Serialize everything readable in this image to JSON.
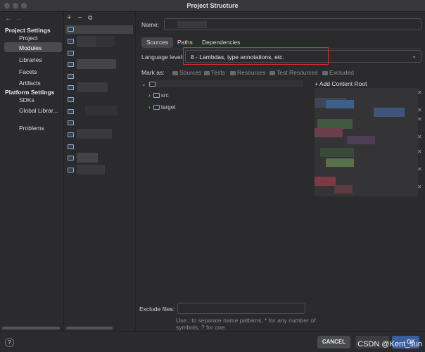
{
  "window": {
    "title": "Project Structure"
  },
  "nav": {
    "back": "←",
    "forward": "→"
  },
  "sidebar": {
    "group_project": "Project Settings",
    "project": "Project",
    "modules": "Modules",
    "libraries": "Libraries",
    "facets": "Facets",
    "artifacts": "Artifacts",
    "group_platform": "Platform Settings",
    "sdks": "SDKs",
    "global_libraries": "Global Librar...",
    "problems": "Problems"
  },
  "module_toolbar": {
    "add": "+",
    "remove": "−",
    "copy": "⧉"
  },
  "details": {
    "name_label": "Name:",
    "tabs": [
      "Sources",
      "Paths",
      "Dependencies"
    ],
    "language_label": "Language level:",
    "language_value": "8 - Lambdas, type annotations, etc.",
    "mark_as_label": "Mark as:",
    "mark_as": [
      "Sources",
      "Tests",
      "Resources",
      "Test Resources",
      "Excluded"
    ],
    "tree": [
      "src",
      "target"
    ],
    "add_content_root": "Add Content Root",
    "exclude_label": "Exclude files:",
    "exclude_hint": "Use ; to separate name patterns, * for any number of symbols, ? for one."
  },
  "footer": {
    "help": "?",
    "cancel": "CANCEL",
    "ok": "OK"
  },
  "watermark": "CSDN @Kent_sun",
  "colors": {
    "highlight": "#e0282e",
    "selection": "#4a4b4f",
    "background": "#2b2b2d"
  }
}
